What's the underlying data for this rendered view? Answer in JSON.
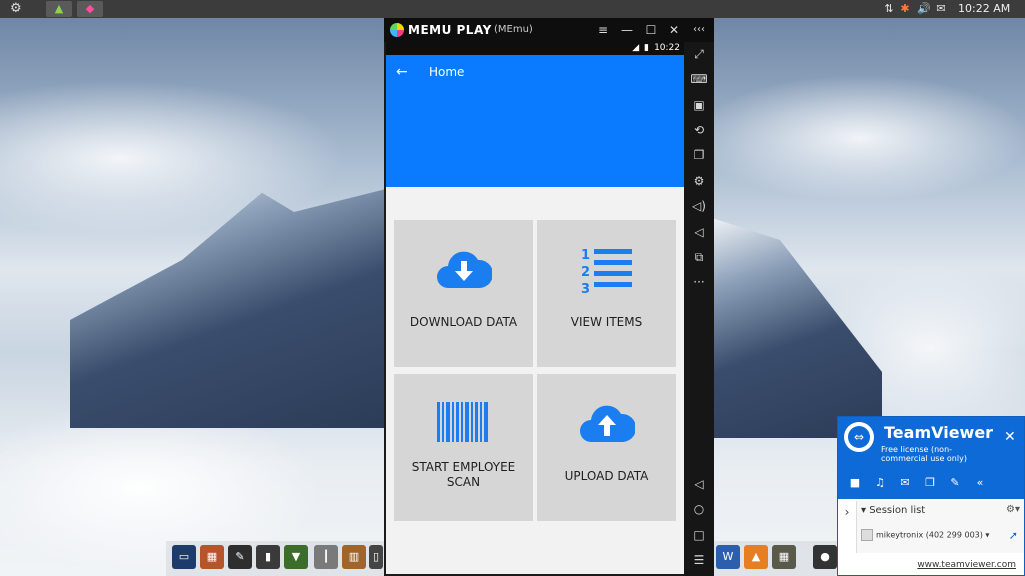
{
  "topbar": {
    "menu_icon": "ubuntu-menu-icon",
    "apps": [
      {
        "name": "android-app",
        "glyph": "▲"
      },
      {
        "name": "memu-app",
        "glyph": "◆"
      }
    ],
    "tray_icons": [
      "network-transfer-icon",
      "updates-icon",
      "volume-icon",
      "chat-icon"
    ],
    "clock": "10:22 AM"
  },
  "memu": {
    "title_logo": "MEMU PLAY",
    "title_sub": "(MEmu)",
    "window_buttons": [
      "≡",
      "—",
      "☐",
      "✕"
    ],
    "status_time": "10:22",
    "appbar": {
      "title": "Home"
    },
    "tiles": [
      {
        "label": "DOWNLOAD DATA",
        "icon": "cloud-download-icon"
      },
      {
        "label": "VIEW ITEMS",
        "icon": "numbered-list-icon"
      },
      {
        "label": "START EMPLOYEE SCAN",
        "icon": "barcode-icon"
      },
      {
        "label": "UPLOAD DATA",
        "icon": "cloud-upload-icon"
      }
    ]
  },
  "sidebar": {
    "buttons": [
      "collapse",
      "fullscreen",
      "keyboard",
      "screenshot",
      "rotate",
      "multi-window",
      "settings",
      "volume-up",
      "volume-down",
      "copy",
      "more",
      "back",
      "home",
      "recents",
      "menu"
    ]
  },
  "teamviewer": {
    "title": "TeamViewer",
    "license": "Free license (non-commercial use only)",
    "session_title": "Session list",
    "contact": "mikeytronix (402 299 003)",
    "footer_link": "www.teamviewer.com",
    "brand_color": "#0e6ad6"
  },
  "colors": {
    "appbar": "#0a7bff",
    "icon_blue": "#1a7df0",
    "tile_bg": "#d6d6d6"
  }
}
